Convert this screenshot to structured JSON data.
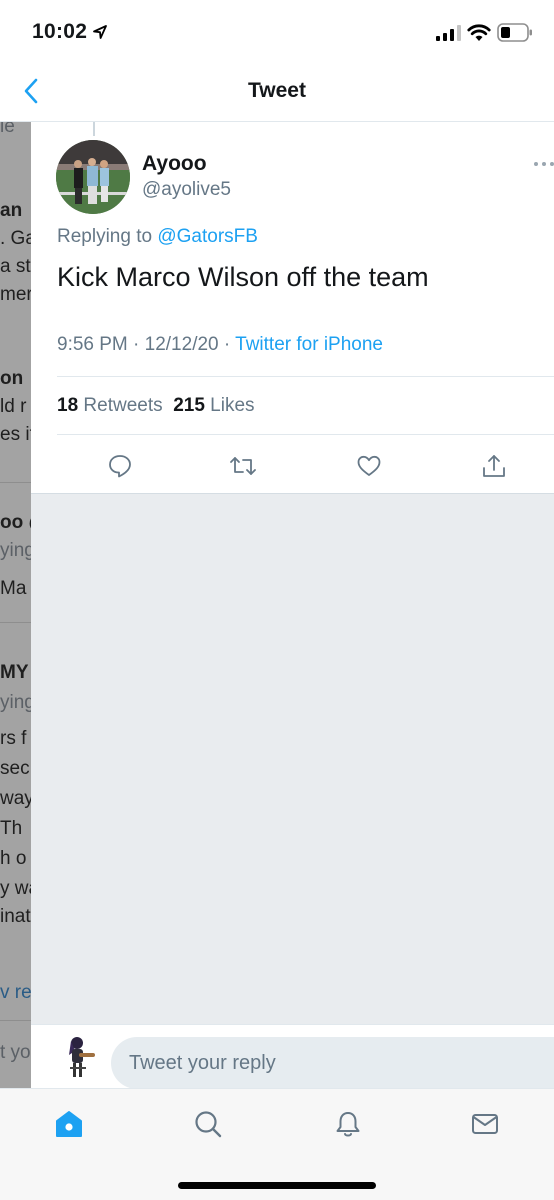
{
  "status_bar": {
    "time": "10:02"
  },
  "nav": {
    "title": "Tweet"
  },
  "peek": {
    "lines": [
      {
        "text": "ie",
        "style": "grey"
      },
      {
        "text": "an",
        "style": "bold"
      },
      {
        "text": ". Ga",
        "style": ""
      },
      {
        "text": "a st",
        "style": ""
      },
      {
        "text": "mer",
        "style": ""
      },
      {
        "text": "on",
        "style": "bold"
      },
      {
        "text": "ld r",
        "style": ""
      },
      {
        "text": "es it",
        "style": ""
      },
      {
        "text": "oo @",
        "style": "bold"
      },
      {
        "text": "ying",
        "style": "grey"
      },
      {
        "text": "Ma",
        "style": ""
      },
      {
        "text": "MY",
        "style": "bold"
      },
      {
        "text": "ying",
        "style": "grey"
      },
      {
        "text": "rs f",
        "style": ""
      },
      {
        "text": "sec",
        "style": ""
      },
      {
        "text": "way,",
        "style": ""
      },
      {
        "text": " Th",
        "style": ""
      },
      {
        "text": "h o",
        "style": ""
      },
      {
        "text": "y wa",
        "style": ""
      },
      {
        "text": "inat",
        "style": ""
      },
      {
        "text": "v re",
        "style": "blue"
      },
      {
        "text": "t yo",
        "style": "grey"
      }
    ]
  },
  "tweet": {
    "display_name": "Ayooo",
    "handle": "@ayolive5",
    "replying_prefix": "Replying to ",
    "replying_to": "@GatorsFB",
    "text": "Kick Marco Wilson off the team",
    "timestamp": "9:56 PM · 12/12/20 · ",
    "source": "Twitter for iPhone",
    "retweets_count": "18",
    "retweets_label": " Retweets  ",
    "likes_count": "215",
    "likes_label": " Likes"
  },
  "composer": {
    "placeholder": "Tweet your reply"
  },
  "tabs": [
    "home-icon",
    "search-icon",
    "notifications-icon",
    "messages-icon"
  ],
  "colors": {
    "accent": "#1da1f2",
    "secondary_text": "#657786"
  }
}
